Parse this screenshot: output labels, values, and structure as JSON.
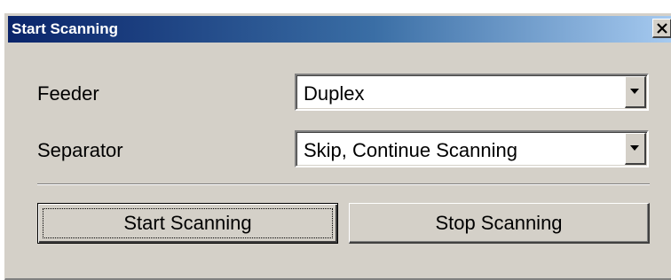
{
  "window": {
    "title": "Start Scanning",
    "close_glyph": "close-icon"
  },
  "form": {
    "feeder": {
      "label": "Feeder",
      "value": "Duplex"
    },
    "separator": {
      "label": "Separator",
      "value": "Skip, Continue Scanning"
    }
  },
  "actions": {
    "start_label": "Start Scanning",
    "stop_label": "Stop Scanning"
  },
  "colors": {
    "titlebar_start": "#0a246a",
    "titlebar_end": "#a6caf0",
    "face": "#d4d0c8"
  }
}
